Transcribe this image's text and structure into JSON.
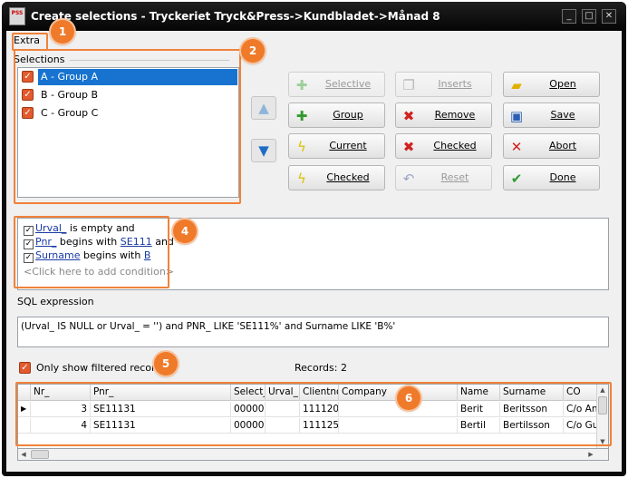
{
  "window": {
    "title": "Create selections - Tryckeriet Tryck&Press->Kundbladet->Månad 8",
    "app_icon_text": "PSS",
    "controls": {
      "minimize": "_",
      "maximize": "□",
      "close": "✕"
    }
  },
  "menu": {
    "extra_label": "Extra"
  },
  "selections": {
    "label": "Selections",
    "items": [
      {
        "label": "A - Group A",
        "checked": true,
        "selected": true
      },
      {
        "label": "B - Group B",
        "checked": true,
        "selected": false
      },
      {
        "label": "C - Group C",
        "checked": true,
        "selected": false
      }
    ]
  },
  "move_buttons": {
    "up_icon": "arrow-up-icon",
    "down_icon": "arrow-down-icon"
  },
  "buttons": {
    "selective": "Selective",
    "inserts": "Inserts",
    "open": "Open",
    "group": "Group",
    "remove": "Remove",
    "save": "Save",
    "current": "Current",
    "checked": "Checked",
    "abort": "Abort",
    "checked2": "Checked",
    "reset": "Reset",
    "done": "Done"
  },
  "conditions": {
    "rows": [
      {
        "field": "Urval_",
        "text": " is empty and",
        "value": ""
      },
      {
        "field": "Pnr_",
        "text": " begins with ",
        "value": "SE111",
        "tail": " and"
      },
      {
        "field": "Surname",
        "text": " begins with ",
        "value": "B",
        "tail": ""
      }
    ],
    "add_label": "<Click here to add condition>"
  },
  "sql": {
    "label": "SQL expression",
    "expression": "(Urval_ IS NULL or Urval_ = '') and PNR_ LIKE 'SE111%' and Surname LIKE 'B%'"
  },
  "filter": {
    "label": "Only show filtered records",
    "checked": true,
    "records_label": "Records: 2"
  },
  "grid": {
    "columns": [
      "Nr_",
      "Pnr_",
      "Select_",
      "Urval_",
      "Clientno",
      "Company",
      "Name",
      "Surname",
      "CO"
    ],
    "rows": [
      [
        "3",
        "SE11131",
        "00000",
        "",
        "111120",
        "",
        "Berit",
        "Beritsson",
        "C/o An"
      ],
      [
        "4",
        "SE11131",
        "00000",
        "",
        "111125",
        "",
        "Bertil",
        "Bertilsson",
        "C/o Gu"
      ]
    ]
  },
  "markers": [
    "1",
    "2",
    "4",
    "5",
    "6"
  ],
  "colors": {
    "highlight": "#f0823a",
    "selection": "#1773cf",
    "checkbox": "#e25a2d",
    "link": "#1a3aa6"
  }
}
